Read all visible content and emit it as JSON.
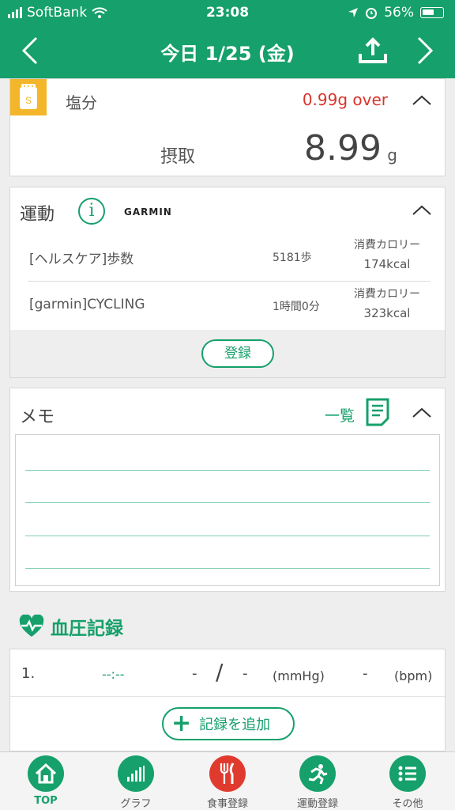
{
  "status": {
    "carrier": "SoftBank",
    "time": "23:08",
    "battery": "56%"
  },
  "nav": {
    "title": "今日 1/25 (金)"
  },
  "salt": {
    "label": "塩分",
    "badge": "S",
    "over": "0.99g over",
    "intake_label": "摂取",
    "intake_value": "8.99",
    "unit": "g"
  },
  "exercise": {
    "title": "運動",
    "info": "i",
    "brand": "GARMIN",
    "rows": [
      {
        "name": "[ヘルスケア]歩数",
        "amount": "5181歩",
        "cal_label": "消費カロリー",
        "cal_value": "174kcal"
      },
      {
        "name": "[garmin]CYCLING",
        "amount": "1時間0分",
        "cal_label": "消費カロリー",
        "cal_value": "323kcal"
      }
    ],
    "register": "登録"
  },
  "memo": {
    "title": "メモ",
    "list_label": "一覧"
  },
  "bp": {
    "title": "血圧記録",
    "row": {
      "index": "1.",
      "time": "--:--",
      "systolic": "-",
      "slash": "/",
      "diastolic": "-",
      "unit_pressure": "(mmHg)",
      "pulse": "-",
      "unit_pulse": "(bpm)"
    },
    "add_label": "記録を追加"
  },
  "tabs": [
    {
      "label": "TOP",
      "icon": "home-icon",
      "active": true
    },
    {
      "label": "グラフ",
      "icon": "bar-chart-icon"
    },
    {
      "label": "食事登録",
      "icon": "fork-knife-icon"
    },
    {
      "label": "運動登録",
      "icon": "runner-icon"
    },
    {
      "label": "その他",
      "icon": "list-icon"
    }
  ],
  "colors": {
    "primary": "#16a06b",
    "warning": "#d9342b",
    "salt_badge": "#f3b62a",
    "meal": "#e03a2f"
  }
}
